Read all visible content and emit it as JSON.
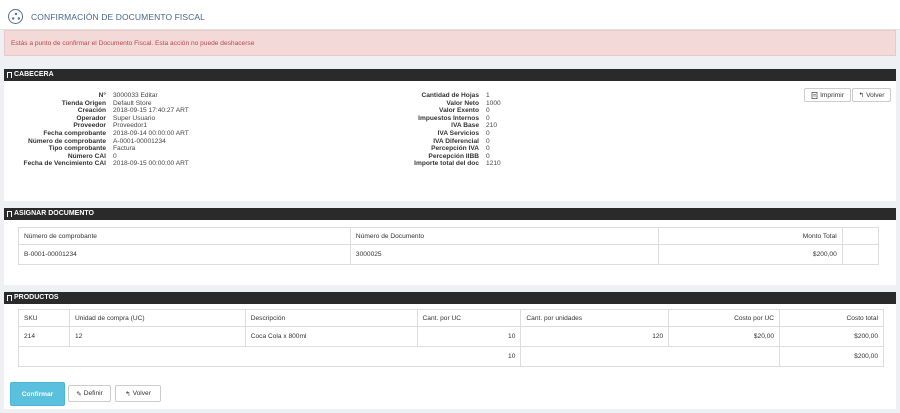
{
  "header": {
    "title": "CONFIRMACIÓN DE DOCUMENTO FISCAL",
    "icon": "logo-icon"
  },
  "alert": {
    "text": "Estás a punto de confirmar el Documento Fiscal. Esta acción no puede deshacerse"
  },
  "cabecera": {
    "title": "CABECERA",
    "left": [
      {
        "k": "N°",
        "v": "3000033 Editar"
      },
      {
        "k": "Tienda Origen",
        "v": "Default Store"
      },
      {
        "k": "Creación",
        "v": "2018-09-15 17:40:27 ART"
      },
      {
        "k": "Operador",
        "v": "Super Usuario"
      },
      {
        "k": "Proveedor",
        "v": "Proveedor1"
      },
      {
        "k": "Fecha comprobante",
        "v": "2018-09-14 00:00:00 ART"
      },
      {
        "k": "Número de comprobante",
        "v": "A-0001-00001234"
      },
      {
        "k": "Tipo comprobante",
        "v": "Factura"
      },
      {
        "k": "Número CAI",
        "v": "0"
      },
      {
        "k": "Fecha de Vencimiento CAI",
        "v": "2018-09-15 00:00:00 ART"
      }
    ],
    "right": [
      {
        "k": "Cantidad de Hojas",
        "v": "1"
      },
      {
        "k": "Valor Neto",
        "v": "1000"
      },
      {
        "k": "Valor Exento",
        "v": "0"
      },
      {
        "k": "Impuestos Internos",
        "v": "0"
      },
      {
        "k": "IVA Base",
        "v": "210"
      },
      {
        "k": "IVA Servicios",
        "v": "0"
      },
      {
        "k": "IVA Diferencial",
        "v": "0"
      },
      {
        "k": "Percepción IVA",
        "v": "0"
      },
      {
        "k": "Percepción IIBB",
        "v": "0"
      },
      {
        "k": "Importe total del doc",
        "v": "1210"
      }
    ],
    "print_label": "Imprimir",
    "back_label": "Volver"
  },
  "asignar": {
    "title": "ASIGNAR DOCUMENTO",
    "headers": [
      "Número de comprobante",
      "Número de Documento",
      "Monto Total"
    ],
    "row": [
      "B-0001-00001234",
      "3000025",
      "$200,00"
    ]
  },
  "productos": {
    "title": "PRODUCTOS",
    "headers": [
      "SKU",
      "Unidad de compra (UC)",
      "Descripción",
      "Cant. por UC",
      "Cant. por unidades",
      "Costo por UC",
      "Costo total"
    ],
    "row": [
      "214",
      "12",
      "Coca Cola x 800ml",
      "10",
      "120",
      "$20,00",
      "$200,00"
    ],
    "totals": {
      "cant_uc": "10",
      "total": "$200,00"
    }
  },
  "actions": {
    "confirm": "Confirmar",
    "define": "Definir",
    "back": "Volver"
  }
}
